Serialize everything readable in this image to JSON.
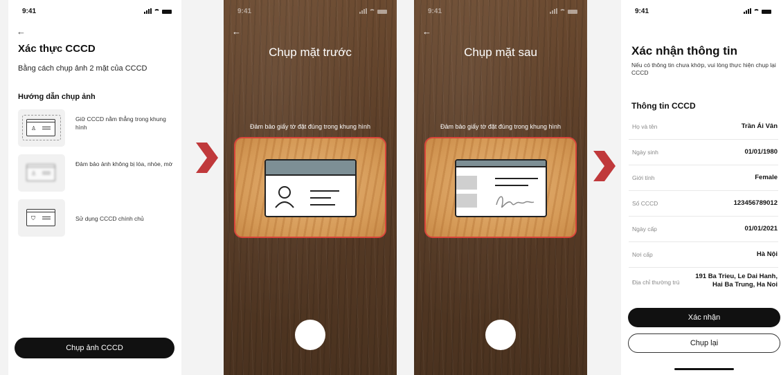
{
  "status": {
    "time": "9:41"
  },
  "colors": {
    "accent": "#c0393b",
    "frame": "#d9453a",
    "button": "#111111"
  },
  "screen1": {
    "back_icon": "arrow-left-icon",
    "title": "Xác thực CCCD",
    "subtitle": "Bằng cách chụp ảnh 2 mặt của CCCD",
    "guide_title": "Hướng dẫn chụp ảnh",
    "guides": [
      {
        "text": "Giữ CCCD nằm thẳng trong khung hình",
        "icon": "id-card-framed-icon"
      },
      {
        "text": "Đảm bảo ảnh không bị lóa, nhòe, mờ",
        "icon": "id-card-blurred-icon"
      },
      {
        "text": "Sử dụng CCCD chính chủ",
        "icon": "id-card-shield-icon"
      }
    ],
    "cta": "Chụp ảnh CCCD"
  },
  "screen2": {
    "title": "Chụp mặt trước",
    "hint": "Đảm bảo giấy tờ đặt đúng trong khung hình",
    "card_icon": "id-card-front-icon"
  },
  "screen3": {
    "title": "Chụp mặt sau",
    "hint": "Đảm bảo giấy tờ đặt đúng trong khung hình",
    "card_icon": "id-card-back-icon"
  },
  "screen4": {
    "title": "Xác nhận thông tin",
    "subtitle": "Nếu có thông tin chưa khớp, vui lòng thực hiện chụp lại CCCD",
    "section": "Thông tin CCCD",
    "rows": [
      {
        "label": "Họ và tên",
        "value": "Trần Ái Vân"
      },
      {
        "label": "Ngày sinh",
        "value": "01/01/1980"
      },
      {
        "label": "Giới tính",
        "value": "Female"
      },
      {
        "label": "Số CCCD",
        "value": "123456789012"
      },
      {
        "label": "Ngày cấp",
        "value": "01/01/2021"
      },
      {
        "label": "Nơi cấp",
        "value": "Hà Nội"
      },
      {
        "label": "Địa chỉ thường trú",
        "value": "191 Ba Trieu, Le Dai Hanh, Hai Ba Trung, Ha Noi"
      }
    ],
    "confirm": "Xác nhận",
    "retake": "Chụp lại"
  }
}
